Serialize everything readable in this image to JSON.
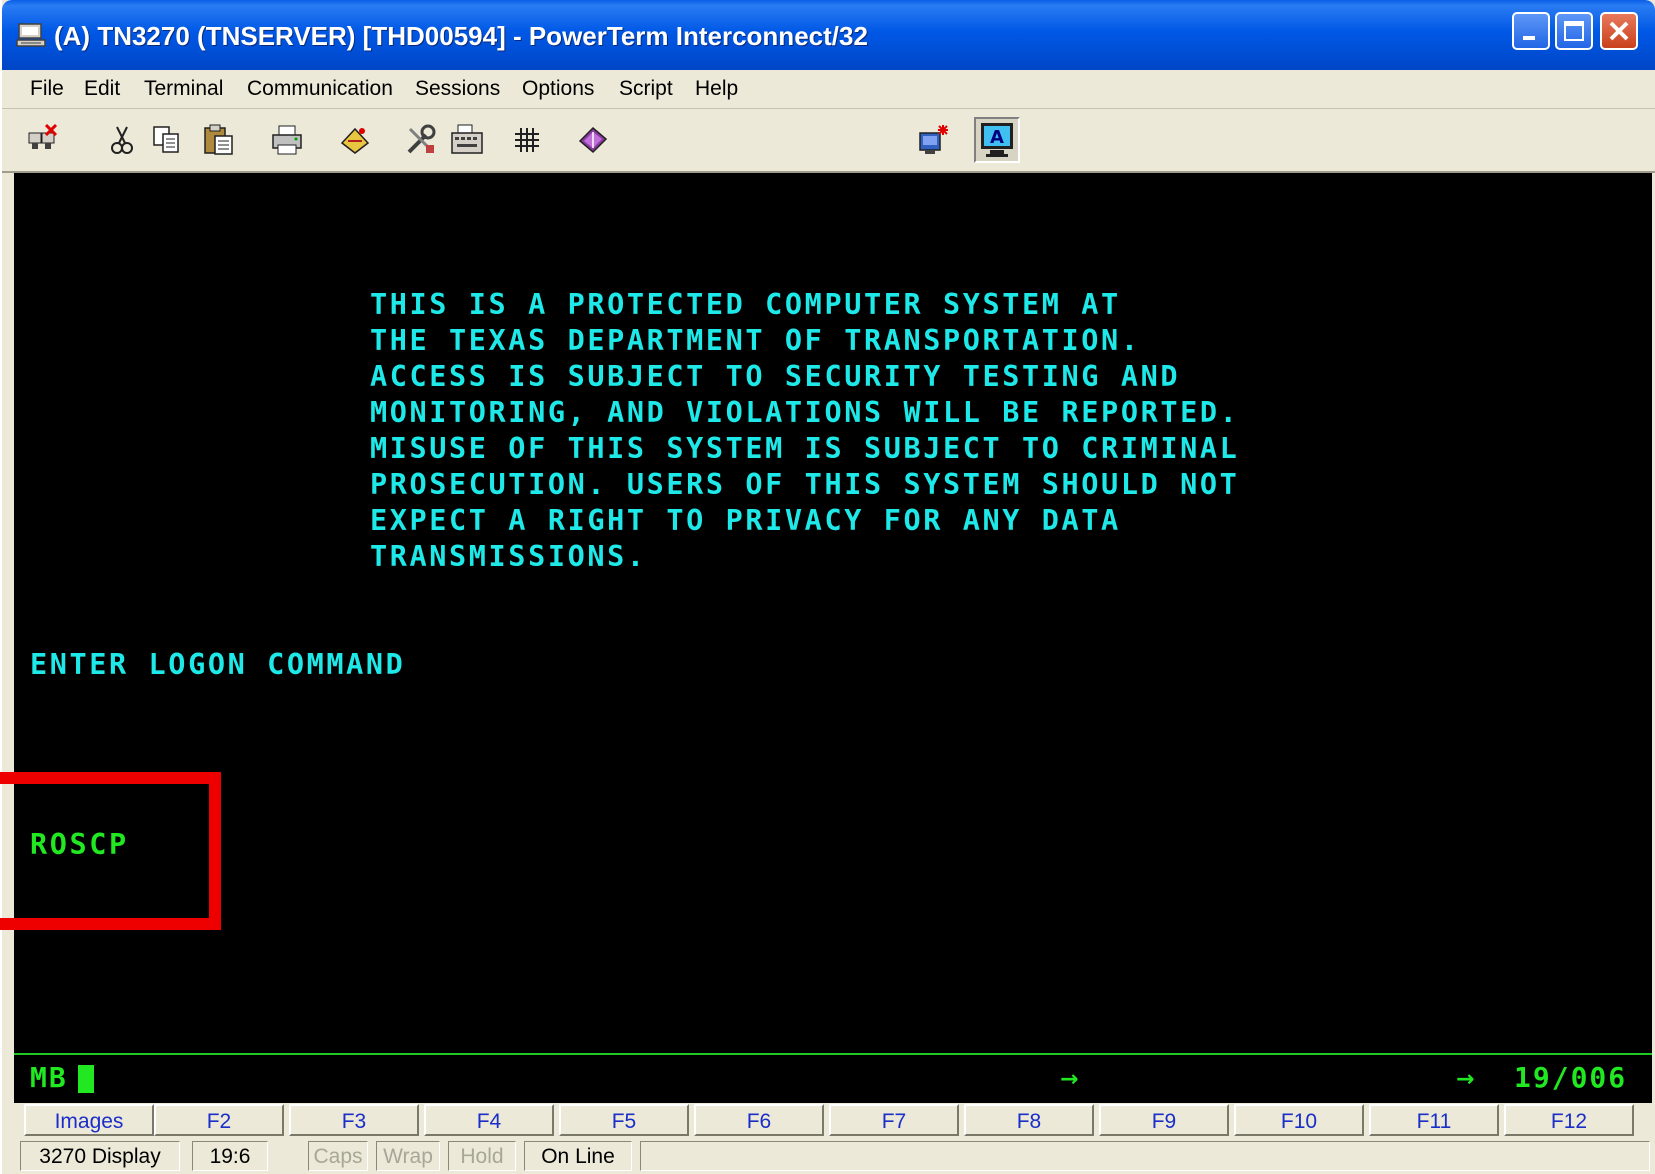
{
  "window": {
    "title": "(A) TN3270 (TNSERVER) [THD00594] - PowerTerm Interconnect/32"
  },
  "menu": {
    "items": [
      "File",
      "Edit",
      "Terminal",
      "Communication",
      "Sessions",
      "Options",
      "Script",
      "Help"
    ]
  },
  "toolbar": {
    "icons": [
      "disconnect-icon",
      "cut-icon",
      "copy-icon",
      "paste-icon",
      "print-icon",
      "macro-icon",
      "settings-icon",
      "keyboard-icon",
      "grid-icon",
      "book-icon",
      "new-session-icon",
      "display-icon"
    ]
  },
  "terminal": {
    "banner_lines": [
      "THIS IS A PROTECTED COMPUTER SYSTEM AT",
      "THE TEXAS DEPARTMENT OF TRANSPORTATION.",
      "ACCESS IS SUBJECT TO SECURITY TESTING AND",
      "MONITORING, AND VIOLATIONS WILL BE REPORTED.",
      "MISUSE OF THIS SYSTEM IS SUBJECT TO CRIMINAL",
      "PROSECUTION. USERS OF THIS SYSTEM SHOULD NOT",
      "EXPECT A RIGHT TO PRIVACY FOR ANY DATA",
      "TRANSMISSIONS."
    ],
    "prompt": "ENTER LOGON COMMAND",
    "input_value": "ROSCP",
    "text_color": "#1ee8e8",
    "input_color": "#22e822"
  },
  "oia": {
    "indicator": "MB",
    "arrow": "→",
    "cursor_position": "19/006"
  },
  "function_keys": [
    "Images",
    "F2",
    "F3",
    "F4",
    "F5",
    "F6",
    "F7",
    "F8",
    "F9",
    "F10",
    "F11",
    "F12"
  ],
  "status_bar": {
    "mode": "3270 Display",
    "position": "19:6",
    "caps": "Caps",
    "wrap": "Wrap",
    "hold": "Hold",
    "connection": "On Line"
  },
  "annotation": {
    "color": "#ee0000"
  }
}
